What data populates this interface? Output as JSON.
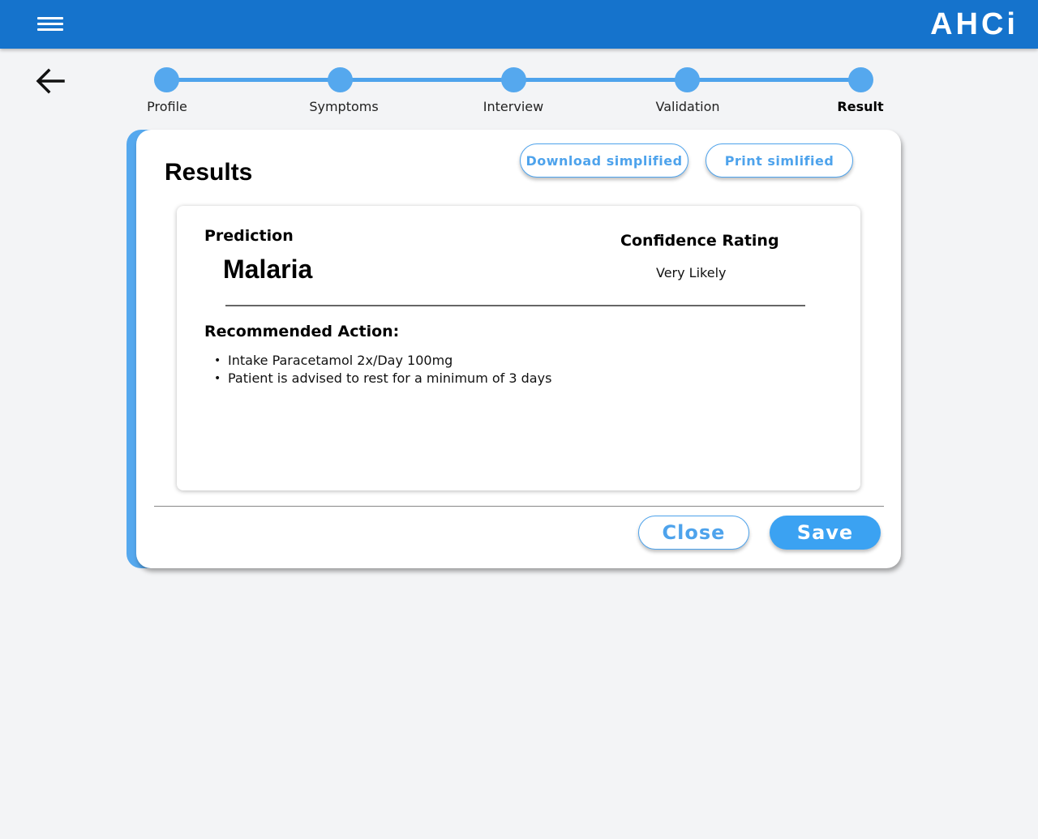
{
  "app": {
    "logo": "AHCi"
  },
  "icons": {
    "menu": "hamburger-menu-icon",
    "back": "arrow-left-icon"
  },
  "colors": {
    "primary": "#1573cc",
    "accent": "#4ea3ec",
    "save": "#3ba2f2"
  },
  "stepper": {
    "steps": [
      {
        "label": "Profile"
      },
      {
        "label": "Symptoms"
      },
      {
        "label": "Interview"
      },
      {
        "label": "Validation"
      },
      {
        "label": "Result"
      }
    ],
    "active": "Result"
  },
  "results": {
    "title": "Results",
    "download_label": "Download simplified",
    "print_label": "Print simlified",
    "prediction_label": "Prediction",
    "prediction_value": "Malaria",
    "confidence_label": "Confidence Rating",
    "confidence_value": "Very Likely",
    "action_label": "Recommended Action:",
    "actions": [
      "Intake Paracetamol 2x/Day 100mg",
      "Patient is advised to rest for a minimum of 3 days"
    ]
  },
  "footer": {
    "close_label": "Close",
    "save_label": "Save"
  }
}
